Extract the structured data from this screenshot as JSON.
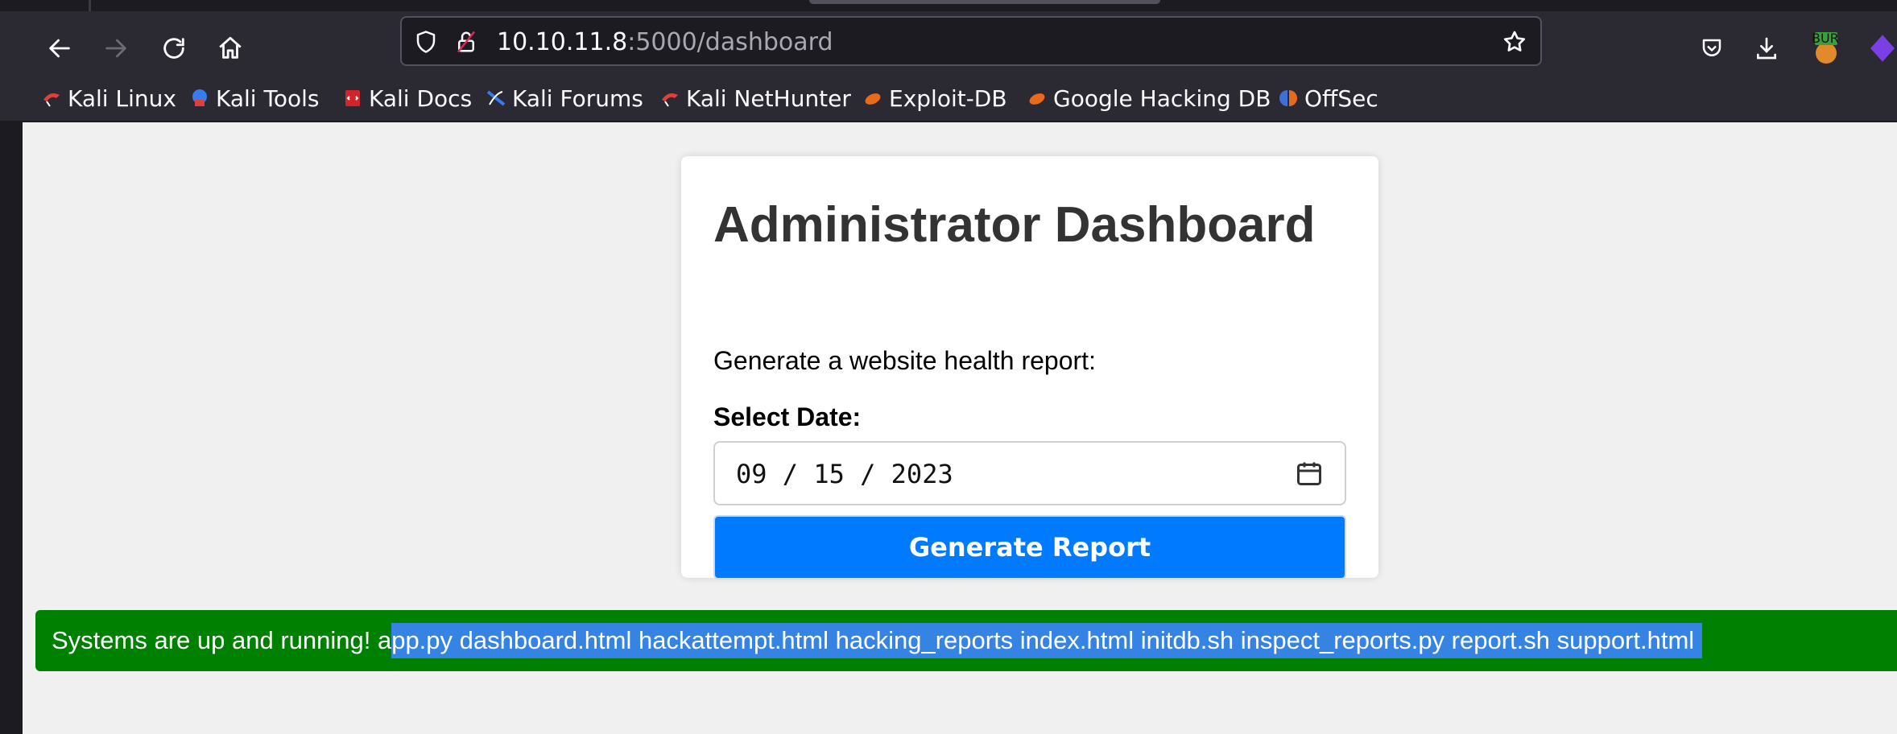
{
  "browser": {
    "url_host": "10.10.11.8",
    "url_path": ":5000/dashboard",
    "burp_badge": "BUR"
  },
  "bookmarks": [
    {
      "label": "Kali Linux",
      "icon": "kali-dragon-icon"
    },
    {
      "label": "Kali Tools",
      "icon": "kali-tools-icon"
    },
    {
      "label": "Kali Docs",
      "icon": "kali-docs-icon"
    },
    {
      "label": "Kali Forums",
      "icon": "kali-forums-icon"
    },
    {
      "label": "Kali NetHunter",
      "icon": "kali-dragon-icon"
    },
    {
      "label": "Exploit-DB",
      "icon": "exploit-db-icon"
    },
    {
      "label": "Google Hacking DB",
      "icon": "exploit-db-icon"
    },
    {
      "label": "OffSec",
      "icon": "offsec-icon"
    }
  ],
  "card": {
    "title": "Administrator Dashboard",
    "subtitle": "Generate a website health report:",
    "date_label": "Select Date:",
    "date_value": "09 / 15 / 2023",
    "button_label": "Generate Report"
  },
  "status": {
    "prefix": "Systems are up and running! a",
    "selected": "pp.py dashboard.html hackattempt.html hacking_reports index.html initdb.sh inspect_reports.py report.sh support.html"
  },
  "colors": {
    "chrome_bg": "#2b2a33",
    "button_blue": "#007bff",
    "status_green": "#008000",
    "selection_blue": "#3584e4"
  }
}
